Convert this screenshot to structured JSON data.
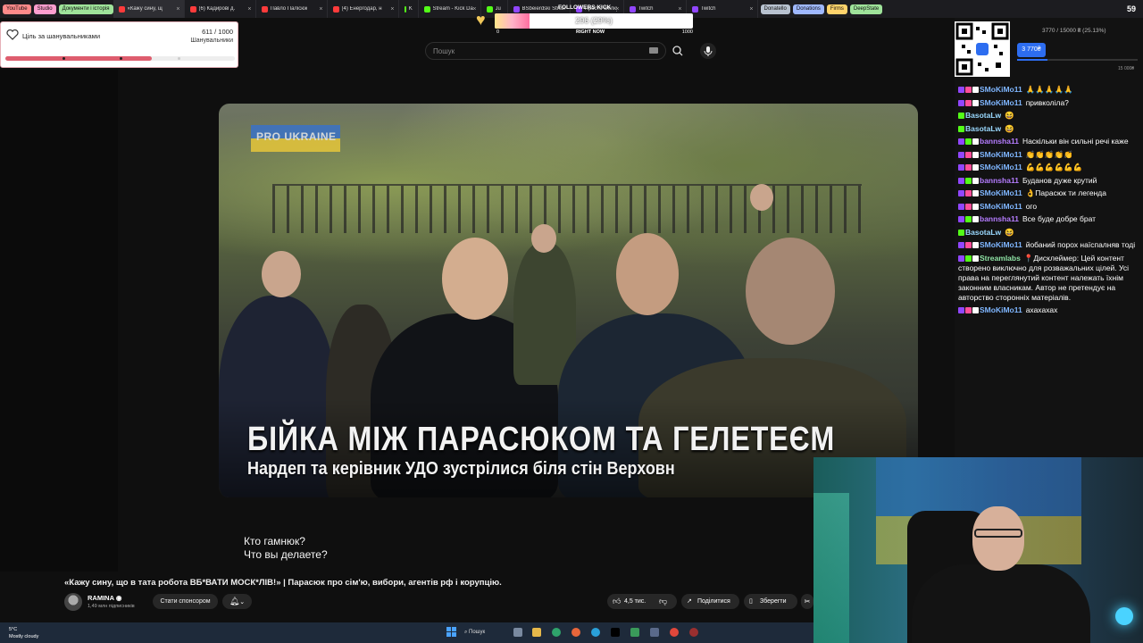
{
  "browser": {
    "bookmarks": [
      {
        "label": "YouTube",
        "color": "#ff8a8a"
      },
      {
        "label": "Studio",
        "color": "#ff9ecf"
      },
      {
        "label": "Документи і історія",
        "color": "#9fe39a"
      }
    ],
    "tabs": [
      {
        "label": "«Кажу сину, щ",
        "active": true,
        "color": "#ff3b3b"
      },
      {
        "label": "(6) Кадирові д.",
        "active": false,
        "color": "#ff3b3b"
      },
      {
        "label": "Павло Палісюк",
        "active": false,
        "color": "#ff3b3b"
      },
      {
        "label": "(4) Енергодар, н",
        "active": false,
        "color": "#ff3b3b"
      },
      {
        "label": "Kick",
        "active": false,
        "color": "#53fc18"
      },
      {
        "label": "Stream - Kick Da",
        "active": false,
        "color": "#53fc18"
      },
      {
        "label": "Just Ch",
        "active": false,
        "color": "#53fc18"
      },
      {
        "label": "BSbeierdski Strea",
        "active": false,
        "color": "#9146ff"
      },
      {
        "label": "Просто спілкуюс",
        "active": false,
        "color": "#9146ff"
      },
      {
        "label": "Twitch",
        "active": false,
        "color": "#9146ff"
      },
      {
        "label": "Twitch",
        "active": false,
        "color": "#9146ff"
      }
    ],
    "bookmarks_right": [
      {
        "label": "Donatello",
        "color": "#b8c2d0"
      },
      {
        "label": "Donations",
        "color": "#9fb8ff"
      },
      {
        "label": "Firms",
        "color": "#ffd36b"
      },
      {
        "label": "DeepState",
        "color": "#9fe39a"
      }
    ],
    "corner_count": "59"
  },
  "goal_widget": {
    "title": "Ціль за шанувальниками",
    "count": "611 / 1000",
    "subtitle": "Шанувальники",
    "progress": 0.611
  },
  "followers_kick": {
    "label": "FOLLOWERS KICK",
    "value": "296 (29%)",
    "progress": 0.296,
    "min": "0",
    "center": "RIGHT NOW",
    "max": "1000"
  },
  "youtube": {
    "search_placeholder": "Пошук",
    "video": {
      "badge": "PRO UKRAINE",
      "headline": "БІЙКА МІЖ ПАРАСЮКОМ ТА ГЕЛЕТЕЄМ",
      "subheadline": "Нардеп та керівник УДО зустрілися біля стін Верховн"
    },
    "subtitles": [
      "Кто гамнюк?",
      "Что вы делаете?"
    ],
    "title": "«Кажу сину, що в тата робота ВБ*ВАТИ МОСК*ЛІВ!» | Парасюк про сім'ю, вибори, агентів рф і корупцію.",
    "channel": "RAMINA",
    "subscribers": "1,49 млн підписників",
    "sponsor_label": "Стати спонсором",
    "likes": "4,5 тис.",
    "share_label": "Поділитися",
    "save_label": "Зберегти"
  },
  "donation": {
    "progress_text": "3770 / 15000 ₴ (25.13%)",
    "current": "3 770₴",
    "goal": "15 000₴",
    "progress": 0.2513
  },
  "chat": [
    {
      "name": "SMoKiMo11",
      "text": "🙏🙏🙏🙏🙏",
      "color": "#7fb6ff",
      "badges": [
        "#9146ff",
        "#ff4f9a",
        "#ffffff"
      ]
    },
    {
      "name": "SMoKiMo11",
      "text": "привколіла?",
      "color": "#7fb6ff",
      "badges": [
        "#9146ff",
        "#ff4f9a",
        "#ffffff"
      ]
    },
    {
      "name": "BasotaLw",
      "text": "😆",
      "color": "#9ad9ff",
      "badges": [
        "#53fc18"
      ]
    },
    {
      "name": "BasotaLw",
      "text": "😆",
      "color": "#9ad9ff",
      "badges": [
        "#53fc18"
      ]
    },
    {
      "name": "bannsha11",
      "text": "Наскільки він сильні речі каже",
      "color": "#b57cff",
      "badges": [
        "#9146ff",
        "#53fc18",
        "#ffffff"
      ]
    },
    {
      "name": "SMoKiMo11",
      "text": "👏👏👏👏👏",
      "color": "#7fb6ff",
      "badges": [
        "#9146ff",
        "#ff4f9a",
        "#ffffff"
      ]
    },
    {
      "name": "SMoKiMo11",
      "text": "💪💪💪💪💪💪",
      "color": "#7fb6ff",
      "badges": [
        "#9146ff",
        "#ff4f9a",
        "#ffffff"
      ]
    },
    {
      "name": "bannsha11",
      "text": "Буданов дуже крутий",
      "color": "#b57cff",
      "badges": [
        "#9146ff",
        "#53fc18",
        "#ffffff"
      ]
    },
    {
      "name": "SMoKiMo11",
      "text": "👌Парасюк ти легенда",
      "color": "#7fb6ff",
      "badges": [
        "#9146ff",
        "#ff4f9a",
        "#ffffff"
      ]
    },
    {
      "name": "SMoKiMo11",
      "text": "ого",
      "color": "#7fb6ff",
      "badges": [
        "#9146ff",
        "#ff4f9a",
        "#ffffff"
      ]
    },
    {
      "name": "bannsha11",
      "text": "Все буде добре брат",
      "color": "#b57cff",
      "badges": [
        "#9146ff",
        "#53fc18",
        "#ffffff"
      ]
    },
    {
      "name": "BasotaLw",
      "text": "😆",
      "color": "#9ad9ff",
      "badges": [
        "#53fc18"
      ]
    },
    {
      "name": "SMoKiMo11",
      "text": "йобаний порох наїспалняв тоді",
      "color": "#7fb6ff",
      "badges": [
        "#9146ff",
        "#ff4f9a",
        "#ffffff"
      ]
    },
    {
      "name": "Streamlabs",
      "text": "📍Дисклеймер: Цей контент створено виключно для розважальних цілей. Усі права на переглянутий контент належать їхнім законним власникам. Автор не претендує на авторство сторонніх матеріалів.",
      "color": "#8fe3a5",
      "badges": [
        "#9146ff",
        "#53fc18",
        "#ffffff"
      ]
    },
    {
      "name": "SMoKiMo11",
      "text": "ахахахах",
      "color": "#7fb6ff",
      "badges": [
        "#9146ff",
        "#ff4f9a",
        "#ffffff"
      ]
    }
  ],
  "taskbar": {
    "weather_temp": "5°C",
    "weather_desc": "Mostly cloudy",
    "search_label": "Пошук"
  }
}
